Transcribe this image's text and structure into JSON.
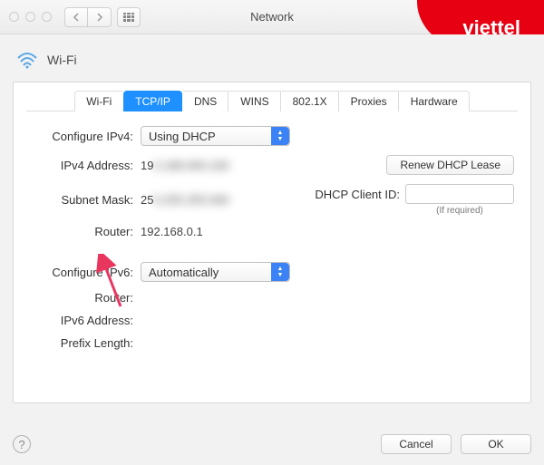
{
  "window": {
    "title": "Network"
  },
  "brand": {
    "logo_text": "viettel"
  },
  "header": {
    "connection_label": "Wi-Fi"
  },
  "tabs": {
    "items": [
      {
        "label": "Wi-Fi"
      },
      {
        "label": "TCP/IP"
      },
      {
        "label": "DNS"
      },
      {
        "label": "WINS"
      },
      {
        "label": "802.1X"
      },
      {
        "label": "Proxies"
      },
      {
        "label": "Hardware"
      }
    ],
    "active_index": 1
  },
  "ipv4": {
    "configure_label": "Configure IPv4:",
    "configure_value": "Using DHCP",
    "address_label": "IPv4 Address:",
    "address_prefix": "19",
    "subnet_label": "Subnet Mask:",
    "subnet_prefix": "25",
    "router_label": "Router:",
    "router_value": "192.168.0.1",
    "renew_label": "Renew DHCP Lease",
    "client_id_label": "DHCP Client ID:",
    "required_note": "(If required)"
  },
  "ipv6": {
    "configure_label": "Configure IPv6:",
    "configure_value": "Automatically",
    "router_label": "Router:",
    "address_label": "IPv6 Address:",
    "prefix_label": "Prefix Length:"
  },
  "footer": {
    "help": "?",
    "cancel": "Cancel",
    "ok": "OK"
  }
}
